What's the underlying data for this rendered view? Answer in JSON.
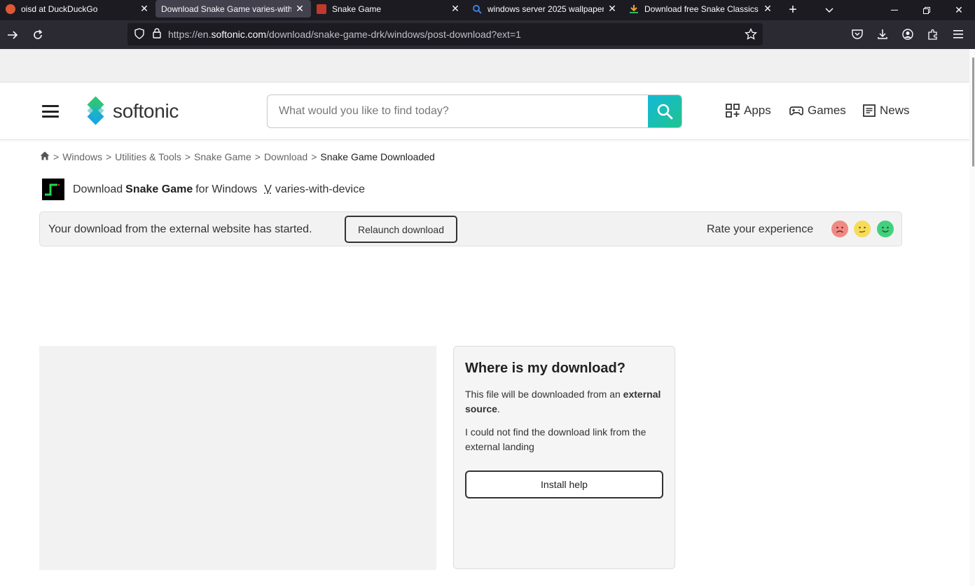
{
  "browser": {
    "tabs": [
      {
        "title": "oisd at DuckDuckGo",
        "favicon": "duckduckgo-icon",
        "favicon_color": "#de5833",
        "active": false
      },
      {
        "title": "Download Snake Game varies-with-",
        "favicon": "",
        "active": true
      },
      {
        "title": "Snake Game",
        "favicon": "snake-game-icon",
        "favicon_color": "#c0392b",
        "active": false
      },
      {
        "title": "windows server 2025 wallpaper",
        "favicon": "search-icon",
        "favicon_color": "#3d7fdd",
        "active": false
      },
      {
        "title": "Download free Snake Classics &",
        "favicon": "download-arrow-icon",
        "favicon_color": "#f5a623",
        "active": false
      }
    ],
    "new_tab_label": "+",
    "url_prefix": "https://en.",
    "url_domain": "softonic.com",
    "url_path": "/download/snake-game-drk/windows/post-download?ext=1"
  },
  "site": {
    "logo_text": "softonic",
    "search_placeholder": "What would you like to find today?",
    "nav": {
      "apps": "Apps",
      "games": "Games",
      "news": "News"
    },
    "brand_colors": {
      "teal": "#14b8d8",
      "green": "#1fc48e"
    }
  },
  "breadcrumb": {
    "items": [
      "Windows",
      "Utilities & Tools",
      "Snake Game",
      "Download"
    ],
    "current": "Snake Game Downloaded",
    "separator": ">"
  },
  "download": {
    "prefix": "Download",
    "app_name": "Snake Game",
    "suffix": "for Windows",
    "version_label": "V",
    "version": "varies-with-device"
  },
  "banner": {
    "message": "Your download from the external website has started.",
    "relaunch_label": "Relaunch download",
    "rate_label": "Rate your experience"
  },
  "help": {
    "title": "Where is my download?",
    "p1_text": "This file will be downloaded from an",
    "p1_strong": "external source",
    "p1_end": ".",
    "p2_text": "I could not find the download link from the external landing",
    "install_label": "Install help"
  }
}
